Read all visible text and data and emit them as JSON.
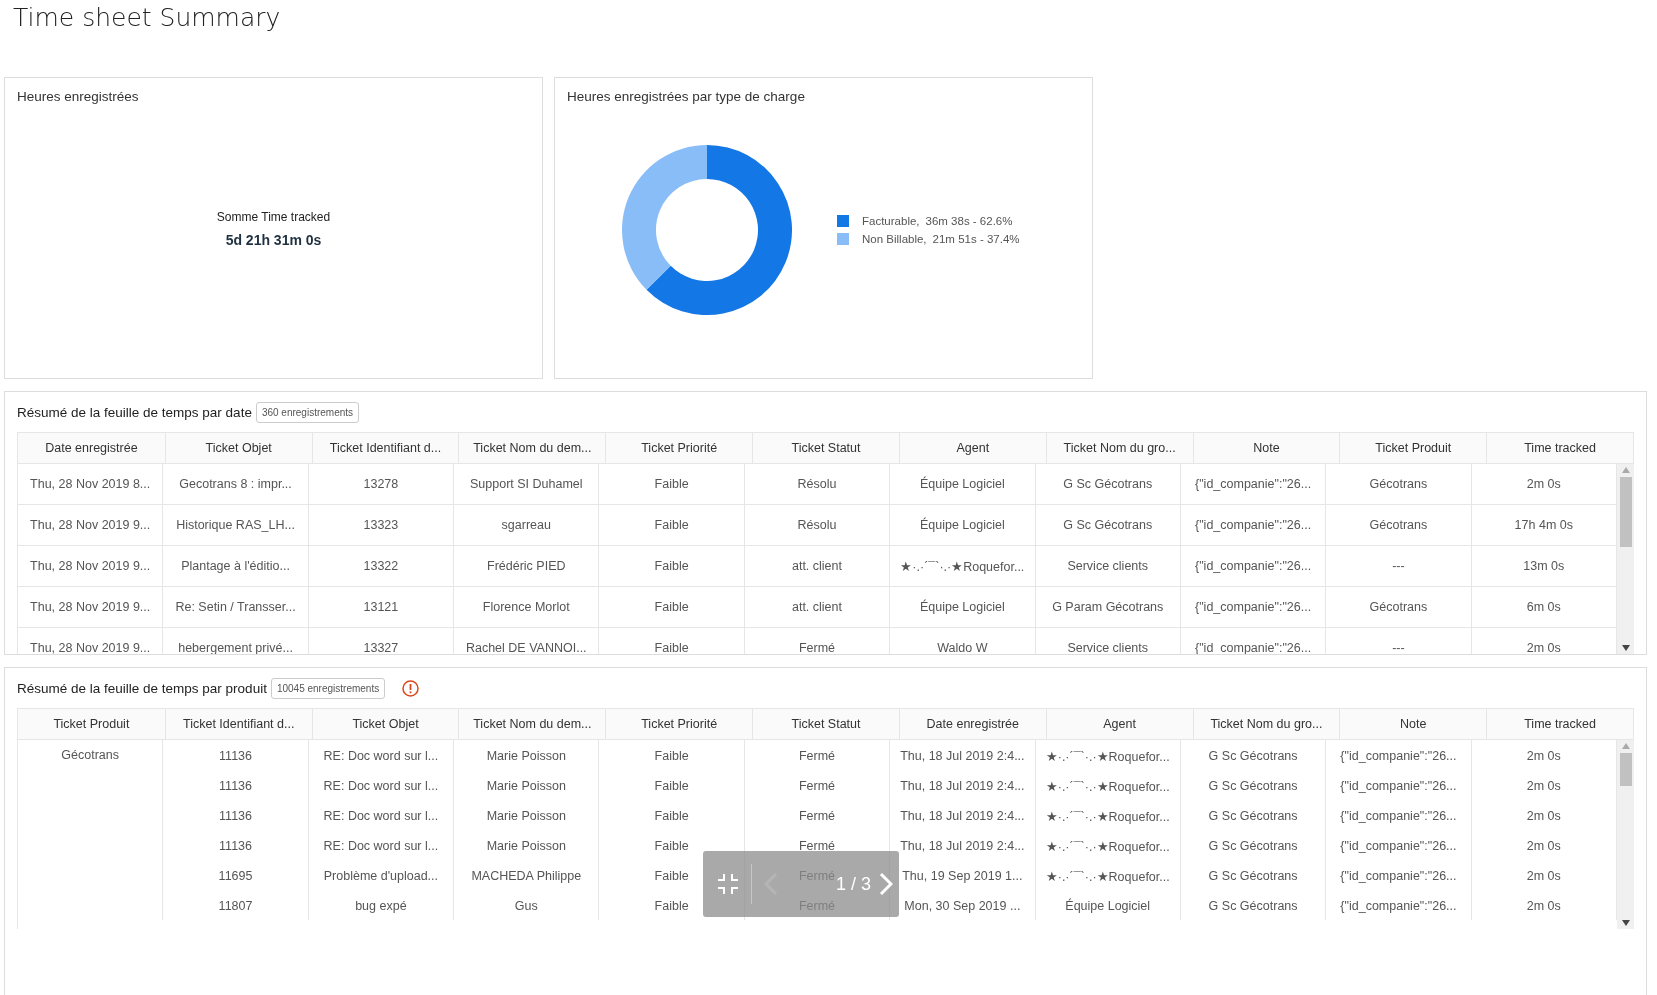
{
  "title": "Time sheet Summary",
  "cards": [
    {
      "kind": "metric",
      "title": "Heures enregistrées",
      "label": "Somme Time tracked",
      "value": "5d 21h 31m 0s"
    },
    {
      "kind": "donut",
      "title": "Heures enregistrées par type de charge",
      "legend": [
        {
          "label": "Facturable,",
          "detail": "36m 38s - 62.6%",
          "color": "#1477e6"
        },
        {
          "label": "Non Billable,",
          "detail": "21m 51s - 37.4%",
          "color": "#88bdf8"
        }
      ],
      "chart_data": {
        "type": "donut",
        "values": [
          62.6,
          37.4
        ]
      }
    }
  ],
  "tables": [
    {
      "title": "Résumé de la feuille de temps par date",
      "count": "360 enregistrements",
      "warning": false,
      "columns": [
        "Date enregistrée",
        "Ticket Objet",
        "Ticket Identifiant d...",
        "Ticket Nom du dem...",
        "Ticket Priorité",
        "Ticket Statut",
        "Agent",
        "Ticket Nom du gro...",
        "Note",
        "Ticket Produit",
        "Time tracked"
      ],
      "rows": [
        [
          "Thu, 28 Nov 2019 8...",
          "Gecotrans 8 : impr...",
          "13278",
          "Support SI Duhamel",
          "Faible",
          "Résolu",
          "Équipe Logiciel",
          "G Sc Gécotrans",
          "{\"id_companie\":\"26...",
          "Gécotrans",
          "2m 0s"
        ],
        [
          "Thu, 28 Nov 2019 9...",
          "Historique RAS_LH...",
          "13323",
          "sgarreau",
          "Faible",
          "Résolu",
          "Équipe Logiciel",
          "G Sc Gécotrans",
          "{\"id_companie\":\"26...",
          "Gécotrans",
          "17h 4m 0s"
        ],
        [
          "Thu, 28 Nov 2019 9...",
          "Plantage à l'éditio...",
          "13322",
          "Frédéric PIED",
          "Faible",
          "att. client",
          "★·.·´¯`·.·★Roquefor...",
          "Service clients",
          "{\"id_companie\":\"26...",
          "---",
          "13m 0s"
        ],
        [
          "Thu, 28 Nov 2019 9...",
          "Re: Setin / Transser...",
          "13121",
          "Florence Morlot",
          "Faible",
          "att. client",
          "Équipe Logiciel",
          "G Param Gécotrans",
          "{\"id_companie\":\"26...",
          "Gécotrans",
          "6m 0s"
        ],
        [
          "Thu, 28 Nov 2019 9...",
          "hebergement privé...",
          "13327",
          "Rachel DE VANNOI...",
          "Faible",
          "Fermé",
          "Waldo W",
          "Service clients",
          "{\"id_companie\":\"26...",
          "---",
          "2m 0s"
        ]
      ]
    },
    {
      "title": "Résumé de la feuille de temps par produit",
      "count": "10045 enregistrements",
      "warning": true,
      "columns": [
        "Ticket Produit",
        "Ticket Identifiant d...",
        "Ticket Objet",
        "Ticket Nom du dem...",
        "Ticket Priorité",
        "Ticket Statut",
        "Date enregistrée",
        "Agent",
        "Ticket Nom du gro...",
        "Note",
        "Time tracked"
      ],
      "groups": [
        {
          "label": "Gécotrans",
          "rows": [
            [
              "11136",
              "RE: Doc word sur l...",
              "Marie Poisson",
              "Faible",
              "Fermé",
              "Thu, 18 Jul 2019 2:4...",
              "★·.·´¯`·.·★Roquefor...",
              "G Sc Gécotrans",
              "{\"id_companie\":\"26...",
              "2m 0s"
            ],
            [
              "11136",
              "RE: Doc word sur l...",
              "Marie Poisson",
              "Faible",
              "Fermé",
              "Thu, 18 Jul 2019 2:4...",
              "★·.·´¯`·.·★Roquefor...",
              "G Sc Gécotrans",
              "{\"id_companie\":\"26...",
              "2m 0s"
            ],
            [
              "11136",
              "RE: Doc word sur l...",
              "Marie Poisson",
              "Faible",
              "Fermé",
              "Thu, 18 Jul 2019 2:4...",
              "★·.·´¯`·.·★Roquefor...",
              "G Sc Gécotrans",
              "{\"id_companie\":\"26...",
              "2m 0s"
            ],
            [
              "11136",
              "RE: Doc word sur l...",
              "Marie Poisson",
              "Faible",
              "Fermé",
              "Thu, 18 Jul 2019 2:4...",
              "★·.·´¯`·.·★Roquefor...",
              "G Sc Gécotrans",
              "{\"id_companie\":\"26...",
              "2m 0s"
            ],
            [
              "11695",
              "Problème d'upload...",
              "MACHEDA Philippe",
              "Faible",
              "Fermé",
              "Thu, 19 Sep 2019 1...",
              "★·.·´¯`·.·★Roquefor...",
              "G Sc Gécotrans",
              "{\"id_companie\":\"26...",
              "2m 0s"
            ],
            [
              "11807",
              "bug expé",
              "Gus",
              "Faible",
              "Fermé",
              "Mon, 30 Sep 2019 ...",
              "Équipe Logiciel",
              "G Sc Gécotrans",
              "{\"id_companie\":\"26...",
              "2m 0s"
            ]
          ]
        }
      ],
      "pager": {
        "text": "1 / 3",
        "prev_disabled": true,
        "next_disabled": false
      }
    }
  ]
}
